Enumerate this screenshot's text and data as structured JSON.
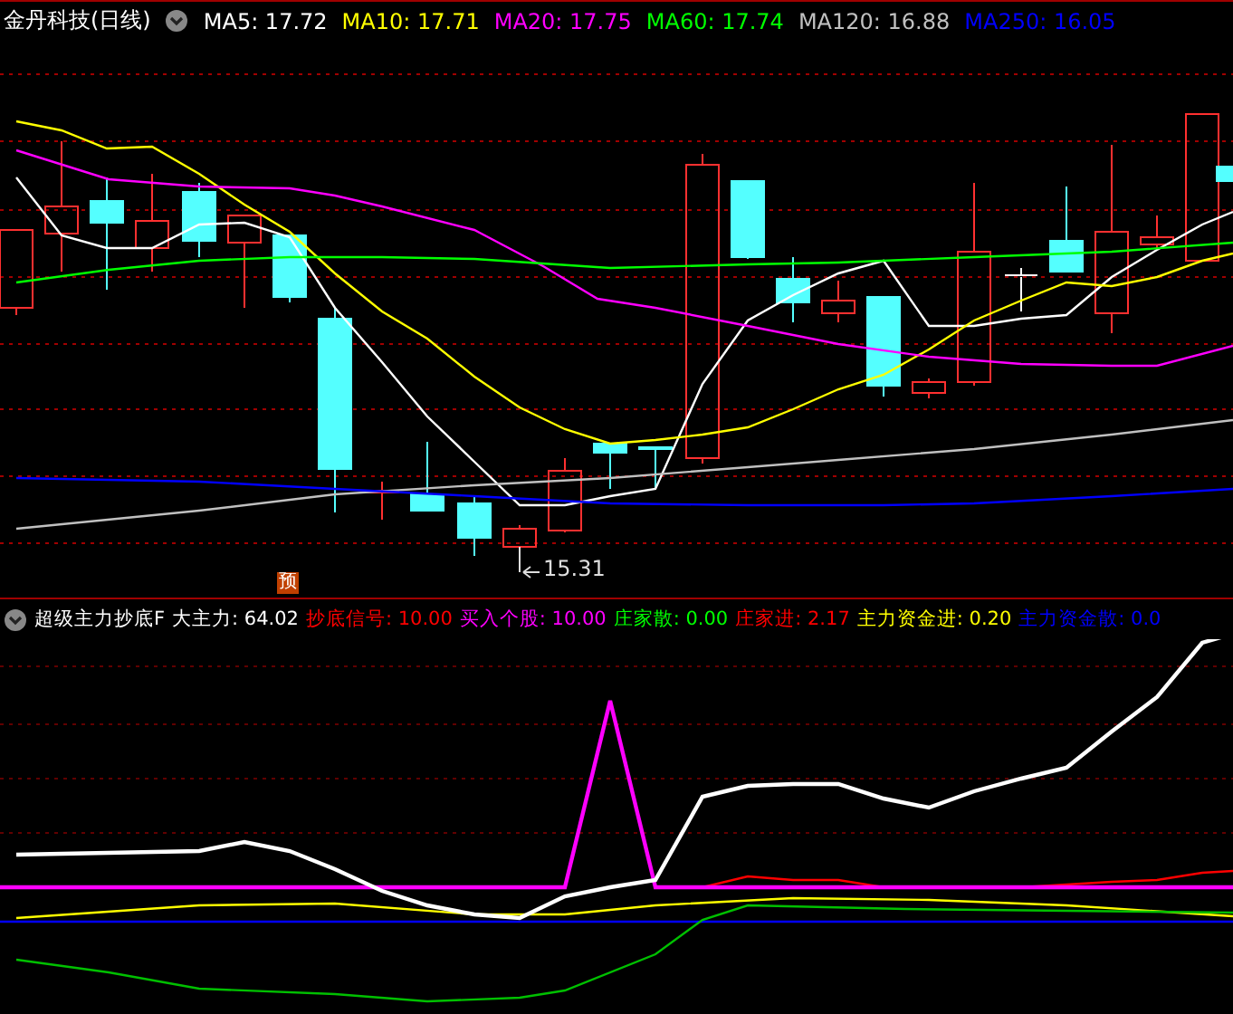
{
  "main_chart": {
    "title": "金丹科技(日线)",
    "legend": [
      {
        "label": "MA5: 17.72",
        "color": "#ffffff"
      },
      {
        "label": "MA10: 17.71",
        "color": "#ffff00"
      },
      {
        "label": "MA20: 17.75",
        "color": "#ff00ff"
      },
      {
        "label": "MA60: 17.74",
        "color": "#00ff00"
      },
      {
        "label": "MA120: 16.88",
        "color": "#c0c0c0"
      },
      {
        "label": "MA250: 16.05",
        "color": "#0000ff"
      }
    ],
    "low_label": "15.31",
    "badge": "预"
  },
  "indicator_panel": {
    "title": "超级主力抄底F",
    "legend": [
      {
        "label": "大主力: 64.02",
        "color": "#ffffff"
      },
      {
        "label": "抄底信号: 10.00",
        "color": "#ff0000"
      },
      {
        "label": "买入个股: 10.00",
        "color": "#ff00ff"
      },
      {
        "label": "庄家散: 0.00",
        "color": "#00ff00"
      },
      {
        "label": "庄家进: 2.17",
        "color": "#ff0000"
      },
      {
        "label": "主力资金进: 0.20",
        "color": "#ffff00"
      },
      {
        "label": "主力资金散: 0.0",
        "color": "#0000ff"
      }
    ]
  }
}
